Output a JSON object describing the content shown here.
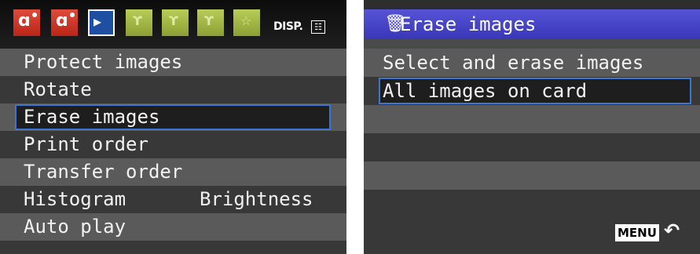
{
  "left_screen": {
    "tabs": [
      {
        "icon": "shooting-menu-1-icon",
        "color": "#c8372a"
      },
      {
        "icon": "shooting-menu-2-icon",
        "color": "#c8372a"
      },
      {
        "icon": "playback-menu-icon",
        "color": "#1f4fa3"
      },
      {
        "icon": "setup-menu-1-icon",
        "color": "#a3b845"
      },
      {
        "icon": "setup-menu-2-icon",
        "color": "#a3b845"
      },
      {
        "icon": "setup-menu-3-icon",
        "color": "#a3b845"
      },
      {
        "icon": "my-menu-icon",
        "color": "#a3b845"
      }
    ],
    "disp_label": "DISP.",
    "menu_items": [
      {
        "label": "Protect images",
        "value": ""
      },
      {
        "label": "Rotate",
        "value": ""
      },
      {
        "label": "Erase images",
        "value": ""
      },
      {
        "label": "Print order",
        "value": ""
      },
      {
        "label": "Transfer order",
        "value": ""
      },
      {
        "label": "Histogram",
        "value": "Brightness"
      },
      {
        "label": "Auto play",
        "value": ""
      }
    ],
    "selected_index": 2
  },
  "right_screen": {
    "title": "Erase images",
    "options": [
      {
        "label": "Select and erase images"
      },
      {
        "label": "All images on card"
      }
    ],
    "selected_index": 1,
    "menu_button": "MENU",
    "back_icon": "return-arrow-icon",
    "highlight_color": "#3e74d2"
  }
}
